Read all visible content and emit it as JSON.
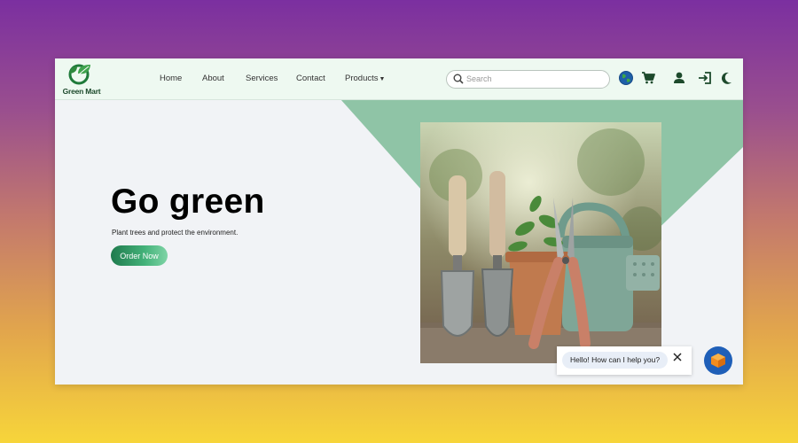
{
  "brand": {
    "name": "Green Mart"
  },
  "nav": {
    "home": "Home",
    "about": "About",
    "services": "Services",
    "contact": "Contact",
    "products": "Products"
  },
  "search": {
    "placeholder": "Search",
    "value": ""
  },
  "icons": {
    "globe": "globe-icon",
    "cart": "cart-icon",
    "user": "user-icon",
    "login": "login-icon",
    "theme": "moon-icon",
    "chat_close": "close-icon",
    "chat_launcher": "chat-bot-icon"
  },
  "hero": {
    "title": "Go green",
    "subtitle": "Plant trees and protect the environment.",
    "cta": "Order Now"
  },
  "chat": {
    "greeting": "Hello! How can I help you?"
  },
  "colors": {
    "accent": "#1f7a4d",
    "navbar_bg": "#eef9f1",
    "triangle": "#8fc4a6",
    "chat_launcher": "#1f5fb8"
  }
}
